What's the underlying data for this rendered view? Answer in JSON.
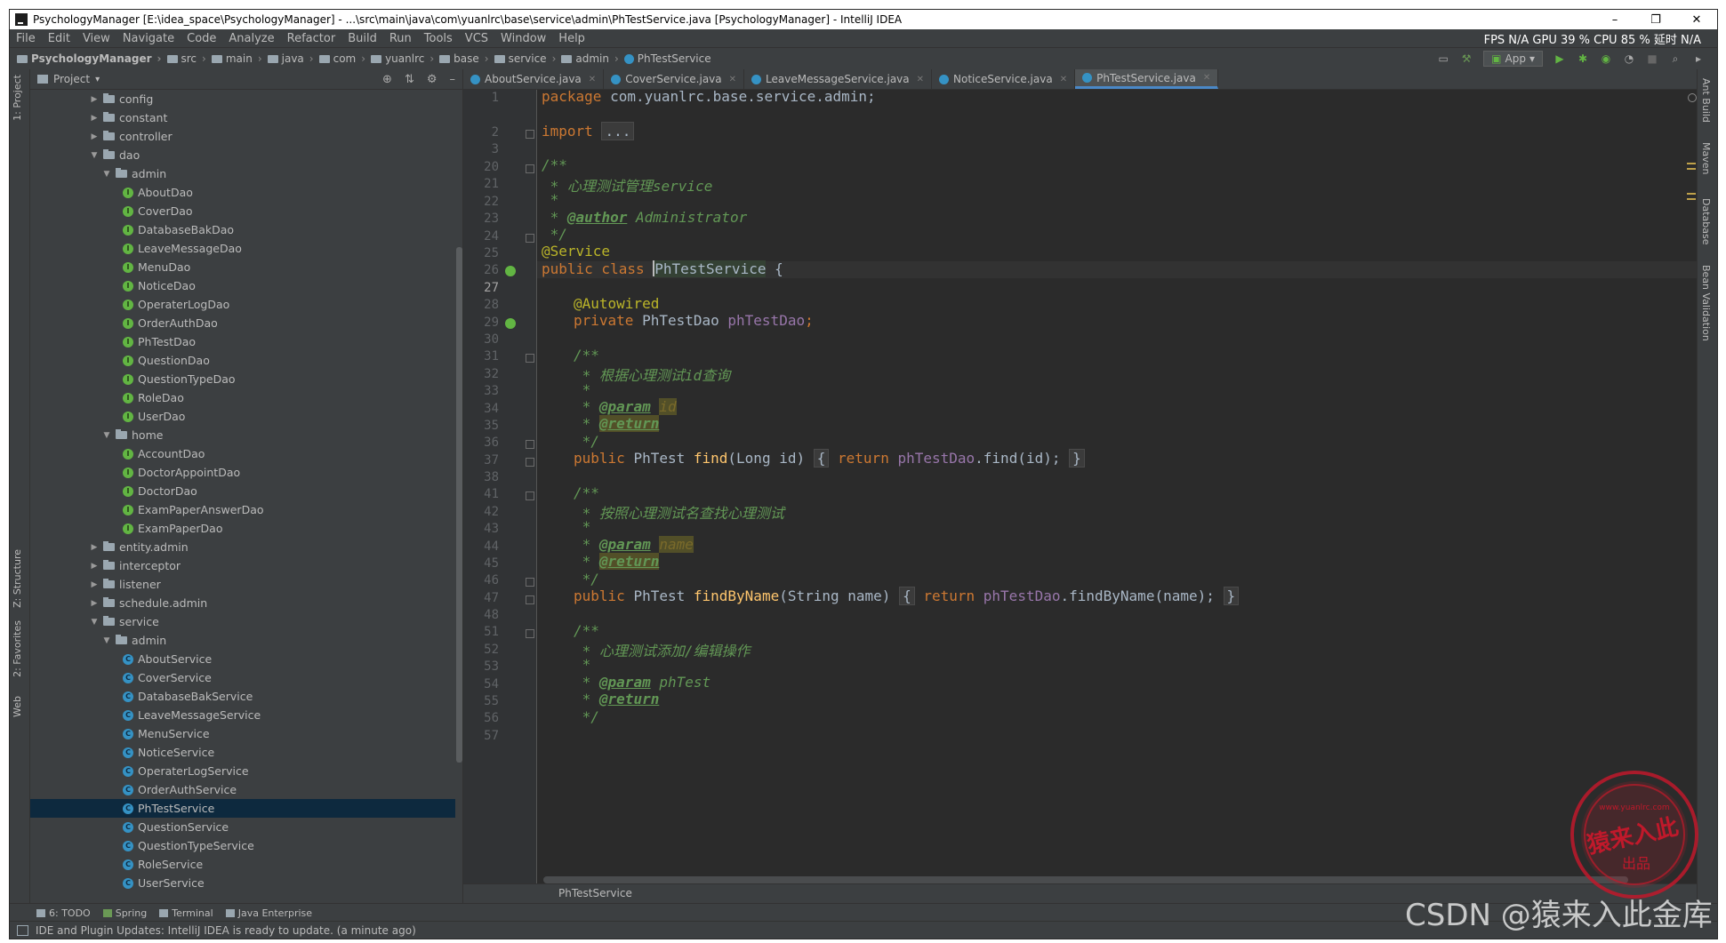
{
  "window": {
    "title": "PsychologyManager [E:\\idea_space\\PsychologyManager] - ...\\src\\main\\java\\com\\yuanlrc\\base\\service\\admin\\PhTestService.java [PsychologyManager] - IntelliJ IDEA",
    "minimize": "–",
    "restore": "❐",
    "close": "✕"
  },
  "menu": [
    "File",
    "Edit",
    "View",
    "Navigate",
    "Code",
    "Analyze",
    "Refactor",
    "Build",
    "Run",
    "Tools",
    "VCS",
    "Window",
    "Help"
  ],
  "perf": "FPS  N/A  GPU  39 %  CPU  85 %  延时  N/A",
  "breadcrumbs": [
    "PsychologyManager",
    "src",
    "main",
    "java",
    "com",
    "yuanlrc",
    "base",
    "service",
    "admin",
    "PhTestService"
  ],
  "run_config": "App",
  "left_strip": {
    "project": "1: Project",
    "structure": "Z: Structure",
    "favorites": "2: Favorites",
    "web": "Web"
  },
  "project_panel": {
    "title": "Project"
  },
  "tree": [
    {
      "label": "config",
      "type": "folder",
      "depth": 1,
      "arrow": "▶"
    },
    {
      "label": "constant",
      "type": "folder",
      "depth": 1,
      "arrow": "▶"
    },
    {
      "label": "controller",
      "type": "folder",
      "depth": 1,
      "arrow": "▶"
    },
    {
      "label": "dao",
      "type": "folder",
      "depth": 1,
      "arrow": "▼"
    },
    {
      "label": "admin",
      "type": "folder",
      "depth": 2,
      "arrow": "▼"
    },
    {
      "label": "AboutDao",
      "type": "interface",
      "depth": 3
    },
    {
      "label": "CoverDao",
      "type": "interface",
      "depth": 3
    },
    {
      "label": "DatabaseBakDao",
      "type": "interface",
      "depth": 3
    },
    {
      "label": "LeaveMessageDao",
      "type": "interface",
      "depth": 3
    },
    {
      "label": "MenuDao",
      "type": "interface",
      "depth": 3
    },
    {
      "label": "NoticeDao",
      "type": "interface",
      "depth": 3
    },
    {
      "label": "OperaterLogDao",
      "type": "interface",
      "depth": 3
    },
    {
      "label": "OrderAuthDao",
      "type": "interface",
      "depth": 3
    },
    {
      "label": "PhTestDao",
      "type": "interface",
      "depth": 3
    },
    {
      "label": "QuestionDao",
      "type": "interface",
      "depth": 3
    },
    {
      "label": "QuestionTypeDao",
      "type": "interface",
      "depth": 3
    },
    {
      "label": "RoleDao",
      "type": "interface",
      "depth": 3
    },
    {
      "label": "UserDao",
      "type": "interface",
      "depth": 3
    },
    {
      "label": "home",
      "type": "folder",
      "depth": 2,
      "arrow": "▼"
    },
    {
      "label": "AccountDao",
      "type": "interface",
      "depth": 3
    },
    {
      "label": "DoctorAppointDao",
      "type": "interface",
      "depth": 3
    },
    {
      "label": "DoctorDao",
      "type": "interface",
      "depth": 3
    },
    {
      "label": "ExamPaperAnswerDao",
      "type": "interface",
      "depth": 3
    },
    {
      "label": "ExamPaperDao",
      "type": "interface",
      "depth": 3
    },
    {
      "label": "entity.admin",
      "type": "folder",
      "depth": 1,
      "arrow": "▶"
    },
    {
      "label": "interceptor",
      "type": "folder",
      "depth": 1,
      "arrow": "▶"
    },
    {
      "label": "listener",
      "type": "folder",
      "depth": 1,
      "arrow": "▶"
    },
    {
      "label": "schedule.admin",
      "type": "folder",
      "depth": 1,
      "arrow": "▶"
    },
    {
      "label": "service",
      "type": "folder",
      "depth": 1,
      "arrow": "▼"
    },
    {
      "label": "admin",
      "type": "folder",
      "depth": 2,
      "arrow": "▼"
    },
    {
      "label": "AboutService",
      "type": "class",
      "depth": 3
    },
    {
      "label": "CoverService",
      "type": "class",
      "depth": 3
    },
    {
      "label": "DatabaseBakService",
      "type": "class",
      "depth": 3
    },
    {
      "label": "LeaveMessageService",
      "type": "class",
      "depth": 3
    },
    {
      "label": "MenuService",
      "type": "class",
      "depth": 3
    },
    {
      "label": "NoticeService",
      "type": "class",
      "depth": 3
    },
    {
      "label": "OperaterLogService",
      "type": "class",
      "depth": 3
    },
    {
      "label": "OrderAuthService",
      "type": "class",
      "depth": 3
    },
    {
      "label": "PhTestService",
      "type": "class",
      "depth": 3,
      "selected": true
    },
    {
      "label": "QuestionService",
      "type": "class",
      "depth": 3
    },
    {
      "label": "QuestionTypeService",
      "type": "class",
      "depth": 3
    },
    {
      "label": "RoleService",
      "type": "class",
      "depth": 3
    },
    {
      "label": "UserService",
      "type": "class",
      "depth": 3
    }
  ],
  "tabs": [
    {
      "label": "AboutService.java",
      "active": false
    },
    {
      "label": "CoverService.java",
      "active": false
    },
    {
      "label": "LeaveMessageService.java",
      "active": false
    },
    {
      "label": "NoticeService.java",
      "active": false
    },
    {
      "label": "PhTestService.java",
      "active": true
    }
  ],
  "line_numbers": [
    "1",
    "2",
    "3",
    "20",
    "21",
    "22",
    "23",
    "24",
    "25",
    "26",
    "27",
    "28",
    "29",
    "30",
    "31",
    "32",
    "33",
    "34",
    "35",
    "36",
    "37",
    "38",
    "41",
    "42",
    "43",
    "44",
    "45",
    "46",
    "47",
    "48",
    "51",
    "52",
    "53",
    "54",
    "55",
    "56",
    "57"
  ],
  "current_line": "27",
  "code": {
    "l1_kw": "package",
    "l1_pkg": " com.yuanlrc.base.service.admin;",
    "l3_kw": "import",
    "l3_fold": "...",
    "l21": "/**",
    "l22": " * 心理测试管理service",
    "l23": " *",
    "l24_star": " * ",
    "l24_tag": "@author",
    "l24_text": " Administrator",
    "l25": " */",
    "l26": "@Service",
    "l27_kw": "public class ",
    "l27_name": "PhTestService",
    "l27_brace": " {",
    "l29": "@Autowired",
    "l30_kw": "private ",
    "l30_type": "PhTestDao ",
    "l30_field": "phTestDao",
    "l30_semi": ";",
    "l32": "/**",
    "l33": " * 根据心理测试id查询",
    "l34": " *",
    "l35_star": " * ",
    "l35_tag": "@param",
    "l35_param": "id",
    "l36_star": " * ",
    "l36_tag": "@return",
    "l37": " */",
    "l38_kw": "public ",
    "l38_type": "PhTest ",
    "l38_meth": "find",
    "l38_args": "(Long id)",
    "l38_open": "{",
    "l38_ret": " return ",
    "l38_field": "phTestDao",
    "l38_call": ".find(id);",
    "l38_close": "}",
    "l42": "/**",
    "l43": " * 按照心理测试名查找心理测试",
    "l44": " *",
    "l45_star": " * ",
    "l45_tag": "@param",
    "l45_param": "name",
    "l46_star": " * ",
    "l46_tag": "@return",
    "l47": " */",
    "l48_kw": "public ",
    "l48_type": "PhTest ",
    "l48_meth": "findByName",
    "l48_args": "(String name)",
    "l48_open": "{",
    "l48_ret": " return ",
    "l48_field": "phTestDao",
    "l48_call": ".findByName(name);",
    "l48_close": "}",
    "l52": "/**",
    "l53": " * 心理测试添加/编辑操作",
    "l54": " *",
    "l55_star": " * ",
    "l55_tag": "@param",
    "l55_param": " phTest",
    "l56_star": " * ",
    "l56_tag": "@return",
    "l57": " */"
  },
  "editor_breadcrumb": "PhTestService",
  "right_strip": [
    "Ant Build",
    "Maven",
    "Database",
    "Bean Validation"
  ],
  "bottom_tools": [
    "6: TODO",
    "Spring",
    "Terminal",
    "Java Enterprise"
  ],
  "status": "IDE and Plugin Updates: IntelliJ IDEA is ready to update. (a minute ago)",
  "watermark": {
    "csdn": "CSDN @猿来入此金库",
    "seal_main": "猿来入此",
    "seal_sub": "出品",
    "seal_url": "www.yuanlrc.com"
  },
  "colors": {
    "keyword": "#cc7832",
    "annotation": "#bbb529",
    "doc_comment": "#629755",
    "field": "#9876aa",
    "method": "#ffc66d",
    "editor_bg": "#2b2b2b",
    "panel_bg": "#3c3f41",
    "selection": "#0d293e",
    "seal_red": "#c0192b"
  }
}
